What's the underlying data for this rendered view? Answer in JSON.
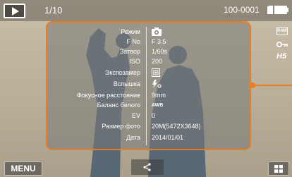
{
  "status": {
    "counter": "1/10",
    "file_id": "100-0001",
    "icons": [
      "play-icon",
      "memory-card-icon",
      "battery-icon"
    ]
  },
  "info_panel": {
    "rows": [
      {
        "label": "Режим",
        "value": "",
        "value_icon": "camera-mode-icon"
      },
      {
        "label": "F No",
        "value": "F 3.5"
      },
      {
        "label": "Затвор",
        "value": "1/60s"
      },
      {
        "label": "ISO",
        "value": "200"
      },
      {
        "label": "Экспозамер",
        "value": "",
        "value_icon": "metering-icon"
      },
      {
        "label": "Вспышка",
        "value": "",
        "value_icon": "flash-off-icon"
      },
      {
        "label": "Фокусное расстояние",
        "value": "9mm"
      },
      {
        "label": "Баланс белого",
        "value": "AWB"
      },
      {
        "label": "EV",
        "value": "0"
      },
      {
        "label": "Размер фото",
        "value": "20M(5472X3648)"
      },
      {
        "label": "Дата",
        "value": "2014/01/01"
      }
    ],
    "side_icons": [
      "raw-icon",
      "protect-key-icon",
      "h5-icon"
    ],
    "side_icon_text": {
      "raw": "RAW",
      "h5": "H5"
    }
  },
  "buttons": {
    "menu_label": "MENU",
    "share_icon": "share-icon",
    "thumbnail_icon": "thumbnail-grid-icon"
  },
  "colors": {
    "accent": "#f07b1c"
  }
}
